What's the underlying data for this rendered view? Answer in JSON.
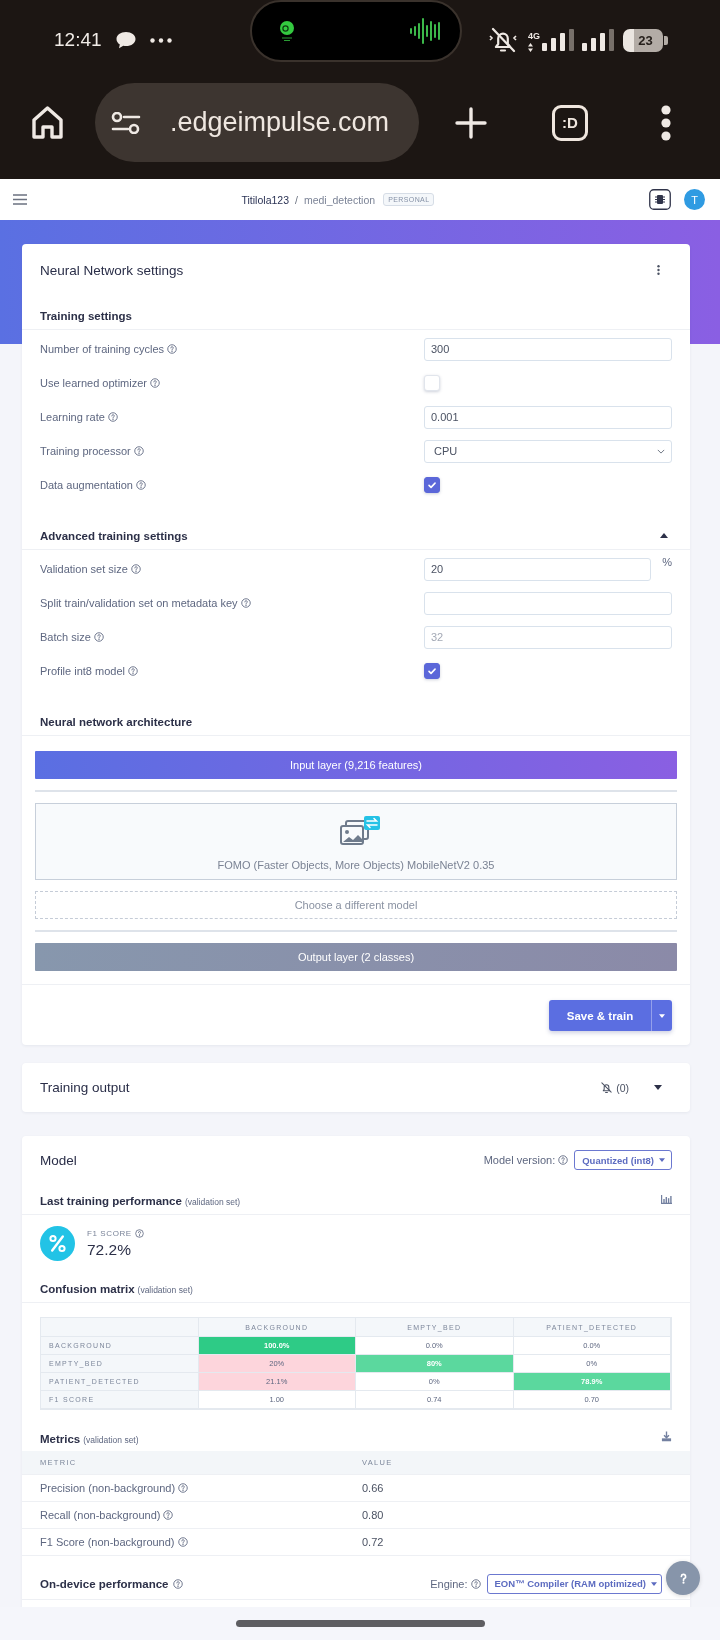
{
  "status_bar": {
    "time": "12:41",
    "network": "4G",
    "battery": "23"
  },
  "browser_bar": {
    "url": ".edgeimpulse.com",
    "tabs": ":D"
  },
  "app_header": {
    "owner": "Titilola123",
    "separator": "/",
    "project": "medi_detection",
    "badge": "PERSONAL",
    "avatar": "T"
  },
  "nn_settings": {
    "title": "Neural Network settings",
    "training_settings": {
      "title": "Training settings",
      "fields": [
        {
          "kind": "input",
          "label": "Number of training cycles",
          "value": "300"
        },
        {
          "kind": "checkbox",
          "label": "Use learned optimizer",
          "checked": false
        },
        {
          "kind": "input",
          "label": "Learning rate",
          "value": "0.001"
        },
        {
          "kind": "select",
          "label": "Training processor",
          "value": "CPU"
        },
        {
          "kind": "checkbox",
          "label": "Data augmentation",
          "checked": true
        }
      ]
    },
    "advanced_settings": {
      "title": "Advanced training settings",
      "expanded": true,
      "fields": [
        {
          "kind": "input",
          "label": "Validation set size",
          "value": "20",
          "unit": "%"
        },
        {
          "kind": "input",
          "label": "Split train/validation set on metadata key"
        },
        {
          "kind": "input",
          "label": "Batch size",
          "placeholder": "32"
        },
        {
          "kind": "checkbox",
          "label": "Profile int8 model",
          "checked": true
        }
      ]
    },
    "architecture": {
      "title": "Neural network architecture",
      "input_layer": "Input layer (9,216 features)",
      "model": "FOMO (Faster Objects, More Objects) MobileNetV2 0.35",
      "choose_model": "Choose a different model",
      "output_layer": "Output layer (2 classes)"
    },
    "save_button": "Save & train"
  },
  "training_output": {
    "title": "Training output",
    "notifications": "(0)",
    "expanded": false
  },
  "model": {
    "title": "Model",
    "version_label": "Model version:",
    "version": "Quantized (int8)",
    "performance": {
      "title": "Last training performance",
      "note": "(validation set)",
      "metric_label": "F1 SCORE",
      "metric_value": "72.2%"
    },
    "confusion_matrix": {
      "title": "Confusion matrix",
      "note": "(validation set)",
      "columns": [
        "BACKGROUND",
        "EMPTY_BED",
        "PATIENT_DETECTED"
      ],
      "rows": [
        {
          "label": "BACKGROUND",
          "cells": [
            {
              "value": "100.0%",
              "kind": "correct",
              "color": "#2ecb86"
            },
            {
              "value": "0.0%",
              "kind": "plain"
            },
            {
              "value": "0.0%",
              "kind": "plain"
            }
          ]
        },
        {
          "label": "EMPTY_BED",
          "cells": [
            {
              "value": "20%",
              "kind": "wrong",
              "color": "#fdd5dc"
            },
            {
              "value": "80%",
              "kind": "correct",
              "color": "#5bd89e"
            },
            {
              "value": "0%",
              "kind": "plain"
            }
          ]
        },
        {
          "label": "PATIENT_DETECTED",
          "cells": [
            {
              "value": "21.1%",
              "kind": "wrong",
              "color": "#fdd5dc"
            },
            {
              "value": "0%",
              "kind": "plain"
            },
            {
              "value": "78.9%",
              "kind": "correct",
              "color": "#5bd89e"
            }
          ]
        },
        {
          "label": "F1 SCORE",
          "cells": [
            {
              "value": "1.00",
              "kind": "plain"
            },
            {
              "value": "0.74",
              "kind": "plain"
            },
            {
              "value": "0.70",
              "kind": "plain"
            }
          ]
        }
      ]
    },
    "metrics": {
      "title": "Metrics",
      "note": "(validation set)",
      "columns": [
        "METRIC",
        "VALUE"
      ],
      "rows": [
        {
          "metric": "Precision (non-background)",
          "value": "0.66"
        },
        {
          "metric": "Recall (non-background)",
          "value": "0.80"
        },
        {
          "metric": "F1 Score (non-background)",
          "value": "0.72"
        }
      ]
    },
    "on_device": {
      "title": "On-device performance",
      "engine_label": "Engine:",
      "engine": "EON™ Compiler (RAM optimized)"
    }
  }
}
